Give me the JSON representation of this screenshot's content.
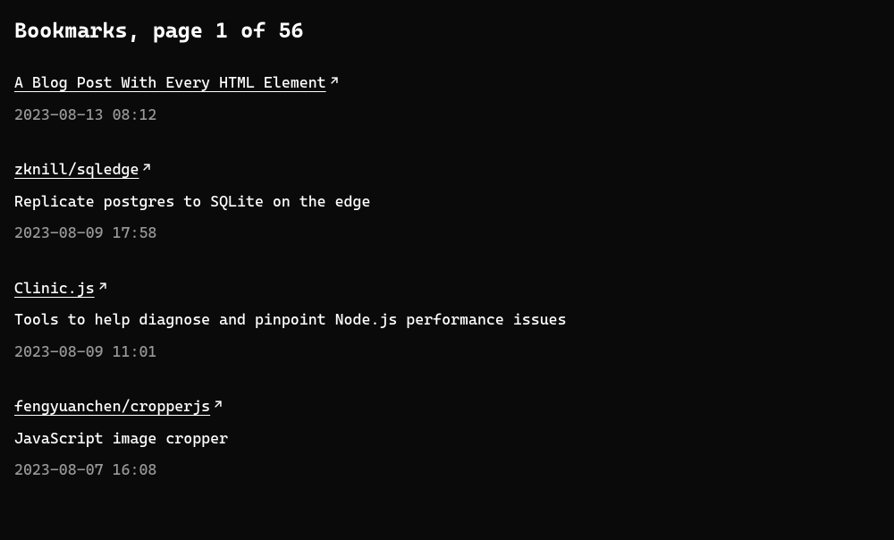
{
  "title": "Bookmarks, page 1 of 56",
  "bookmarks": [
    {
      "title": "A Blog Post With Every HTML Element",
      "description": null,
      "timestamp": "2023-08-13 08:12"
    },
    {
      "title": "zknill/sqledge",
      "description": "Replicate postgres to SQLite on the edge",
      "timestamp": "2023-08-09 17:58"
    },
    {
      "title": "Clinic.js",
      "description": "Tools to help diagnose and pinpoint Node.js performance issues",
      "timestamp": "2023-08-09 11:01"
    },
    {
      "title": "fengyuanchen/cropperjs",
      "description": "JavaScript image cropper",
      "timestamp": "2023-08-07 16:08"
    }
  ]
}
